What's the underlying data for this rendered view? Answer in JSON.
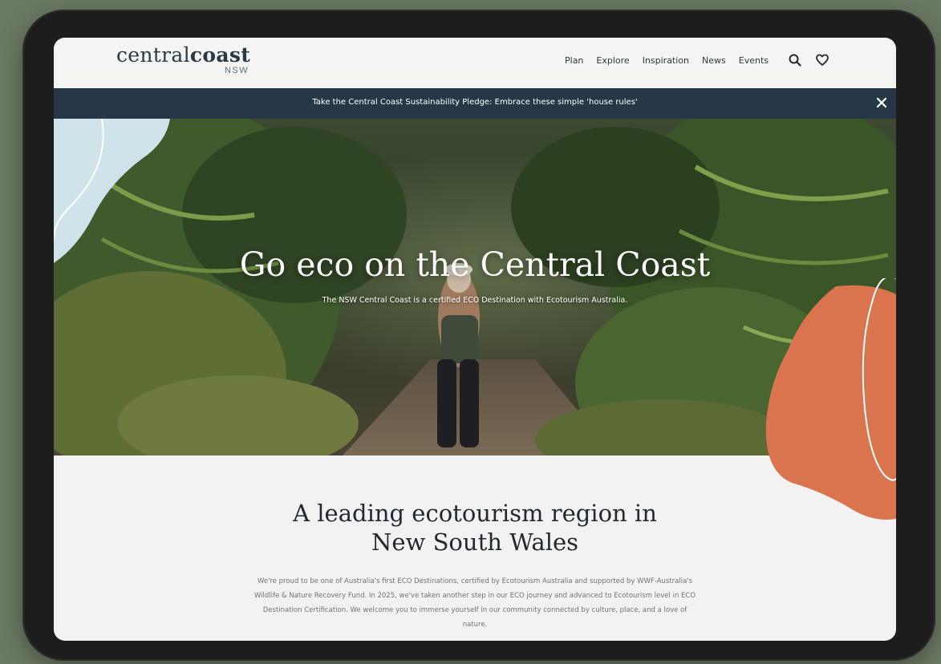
{
  "header": {
    "logo_main_regular": "central",
    "logo_main_bold": "coast",
    "logo_sub": "NSW",
    "nav": [
      "Plan",
      "Explore",
      "Inspiration",
      "News",
      "Events"
    ],
    "icons": [
      "search-icon",
      "heart-icon"
    ]
  },
  "banner": {
    "text": "Take the Central Coast Sustainability Pledge: Embrace these simple 'house rules'",
    "close_icon": "close-icon"
  },
  "hero": {
    "title": "Go eco on the Central Coast",
    "subtitle": "The NSW Central Coast is a certified ECO Destination with Ecotourism Australia."
  },
  "intro": {
    "heading_line1": "A leading ecotourism region in",
    "heading_line2": "New South Wales",
    "paragraph": "We're proud to be one of Australia's first ECO Destinations, certified by Ecotourism Australia and supported by WWF-Australia's Wildlife & Nature Recovery Fund. In 2025, we've taken another step in our ECO journey and advanced to Ecotourism level in ECO Destination Certification. We welcome you to immerse yourself in our community connected by culture, place, and a love of nature."
  },
  "colors": {
    "background": "#6b7a64",
    "banner": "#263847",
    "accent_orange": "#d9744e",
    "accent_blue": "#cfe3ea",
    "text_dark": "#222a31"
  }
}
